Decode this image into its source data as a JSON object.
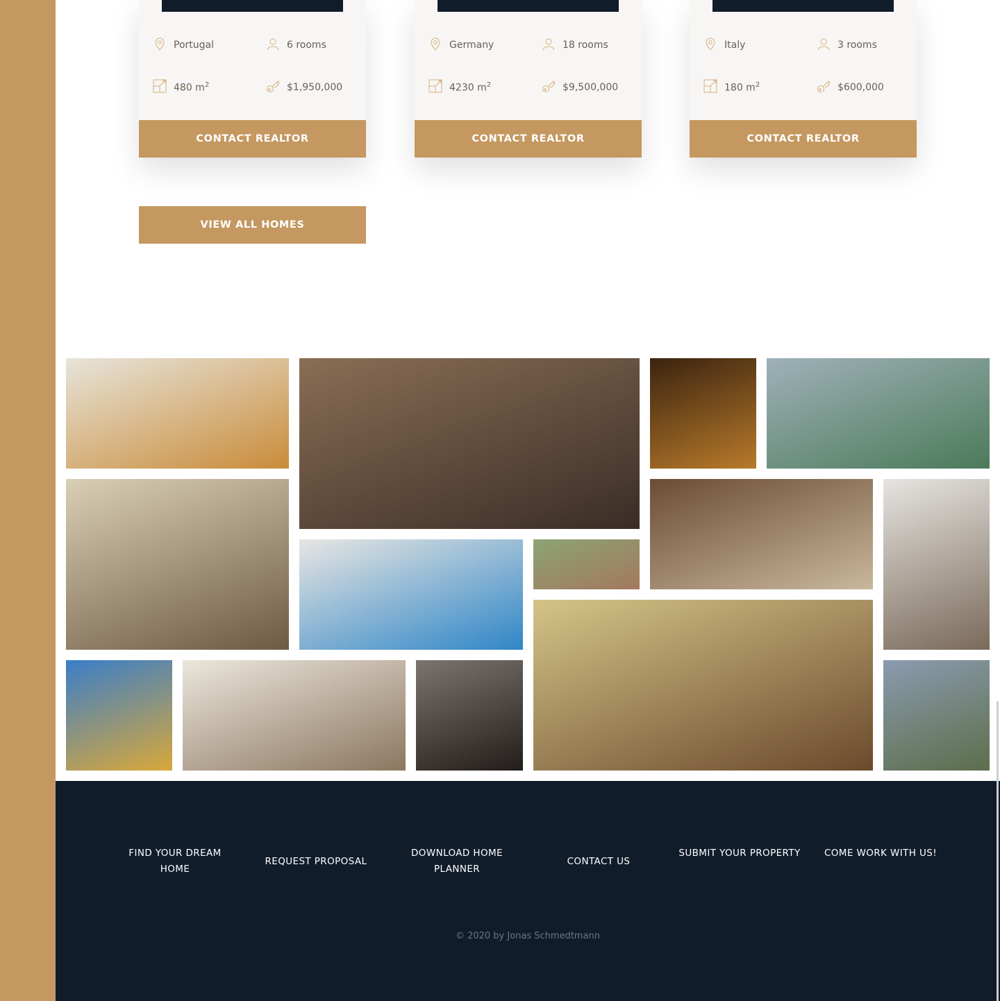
{
  "listings": [
    {
      "country": "Portugal",
      "rooms": "6 rooms",
      "area": "480 m",
      "price": "$1,950,000",
      "cta": "CONTACT REALTOR"
    },
    {
      "country": "Germany",
      "rooms": "18 rooms",
      "area": "4230 m",
      "price": "$9,500,000",
      "cta": "CONTACT REALTOR"
    },
    {
      "country": "Italy",
      "rooms": "3 rooms",
      "area": "180 m",
      "price": "$600,000",
      "cta": "CONTACT REALTOR"
    }
  ],
  "area_sup": "2",
  "view_all": "VIEW ALL HOMES",
  "gallery": [
    "autumn-mansion",
    "modern-living-room",
    "hotel-bar",
    "beach-resort",
    "bright-sitting-room",
    "indoor-pool",
    "brick-house",
    "lodge-lounge",
    "white-kitchen",
    "billiard-room",
    "yellow-villa",
    "dining-living-room",
    "dark-lounge",
    "white-manor"
  ],
  "footer": {
    "links": [
      "FIND YOUR DREAM HOME",
      "REQUEST PROPOSAL",
      "DOWNLOAD HOME PLANNER",
      "CONTACT US",
      "SUBMIT YOUR PROPERTY",
      "COME WORK WITH US!"
    ],
    "copyright": "© 2020 by Jonas Schmedtmann"
  },
  "colors": {
    "accent": "#c49860",
    "dark": "#111c2b",
    "card": "#f7f6f4"
  }
}
